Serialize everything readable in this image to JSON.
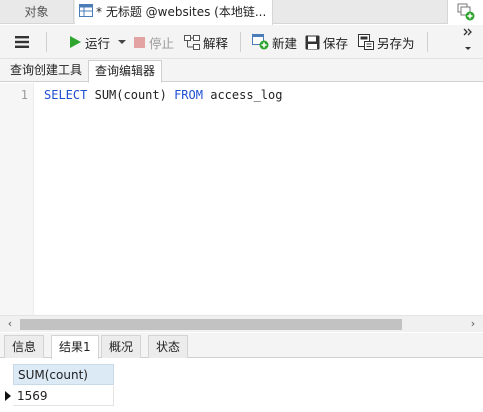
{
  "top_tabs": {
    "objects": "对象",
    "query": "* 无标题 @websites (本地链..."
  },
  "toolbar": {
    "run": "运行",
    "stop": "停止",
    "explain": "解释",
    "new": "新建",
    "save": "保存",
    "save_as": "另存为"
  },
  "sub_tabs": [
    "查询创建工具",
    "查询编辑器"
  ],
  "editor": {
    "line_number": "1",
    "tokens": {
      "select": "SELECT",
      "func": "SUM(count)",
      "from": "FROM",
      "table": "access_log"
    }
  },
  "result_tabs": [
    "信息",
    "结果1",
    "概况",
    "状态"
  ],
  "result": {
    "columns": [
      "SUM(count)"
    ],
    "rows": [
      [
        "1569"
      ]
    ]
  },
  "colors": {
    "keyword": "#1f4fd1",
    "run_icon": "#2fa52f",
    "header_bg": "#dceaf6"
  }
}
